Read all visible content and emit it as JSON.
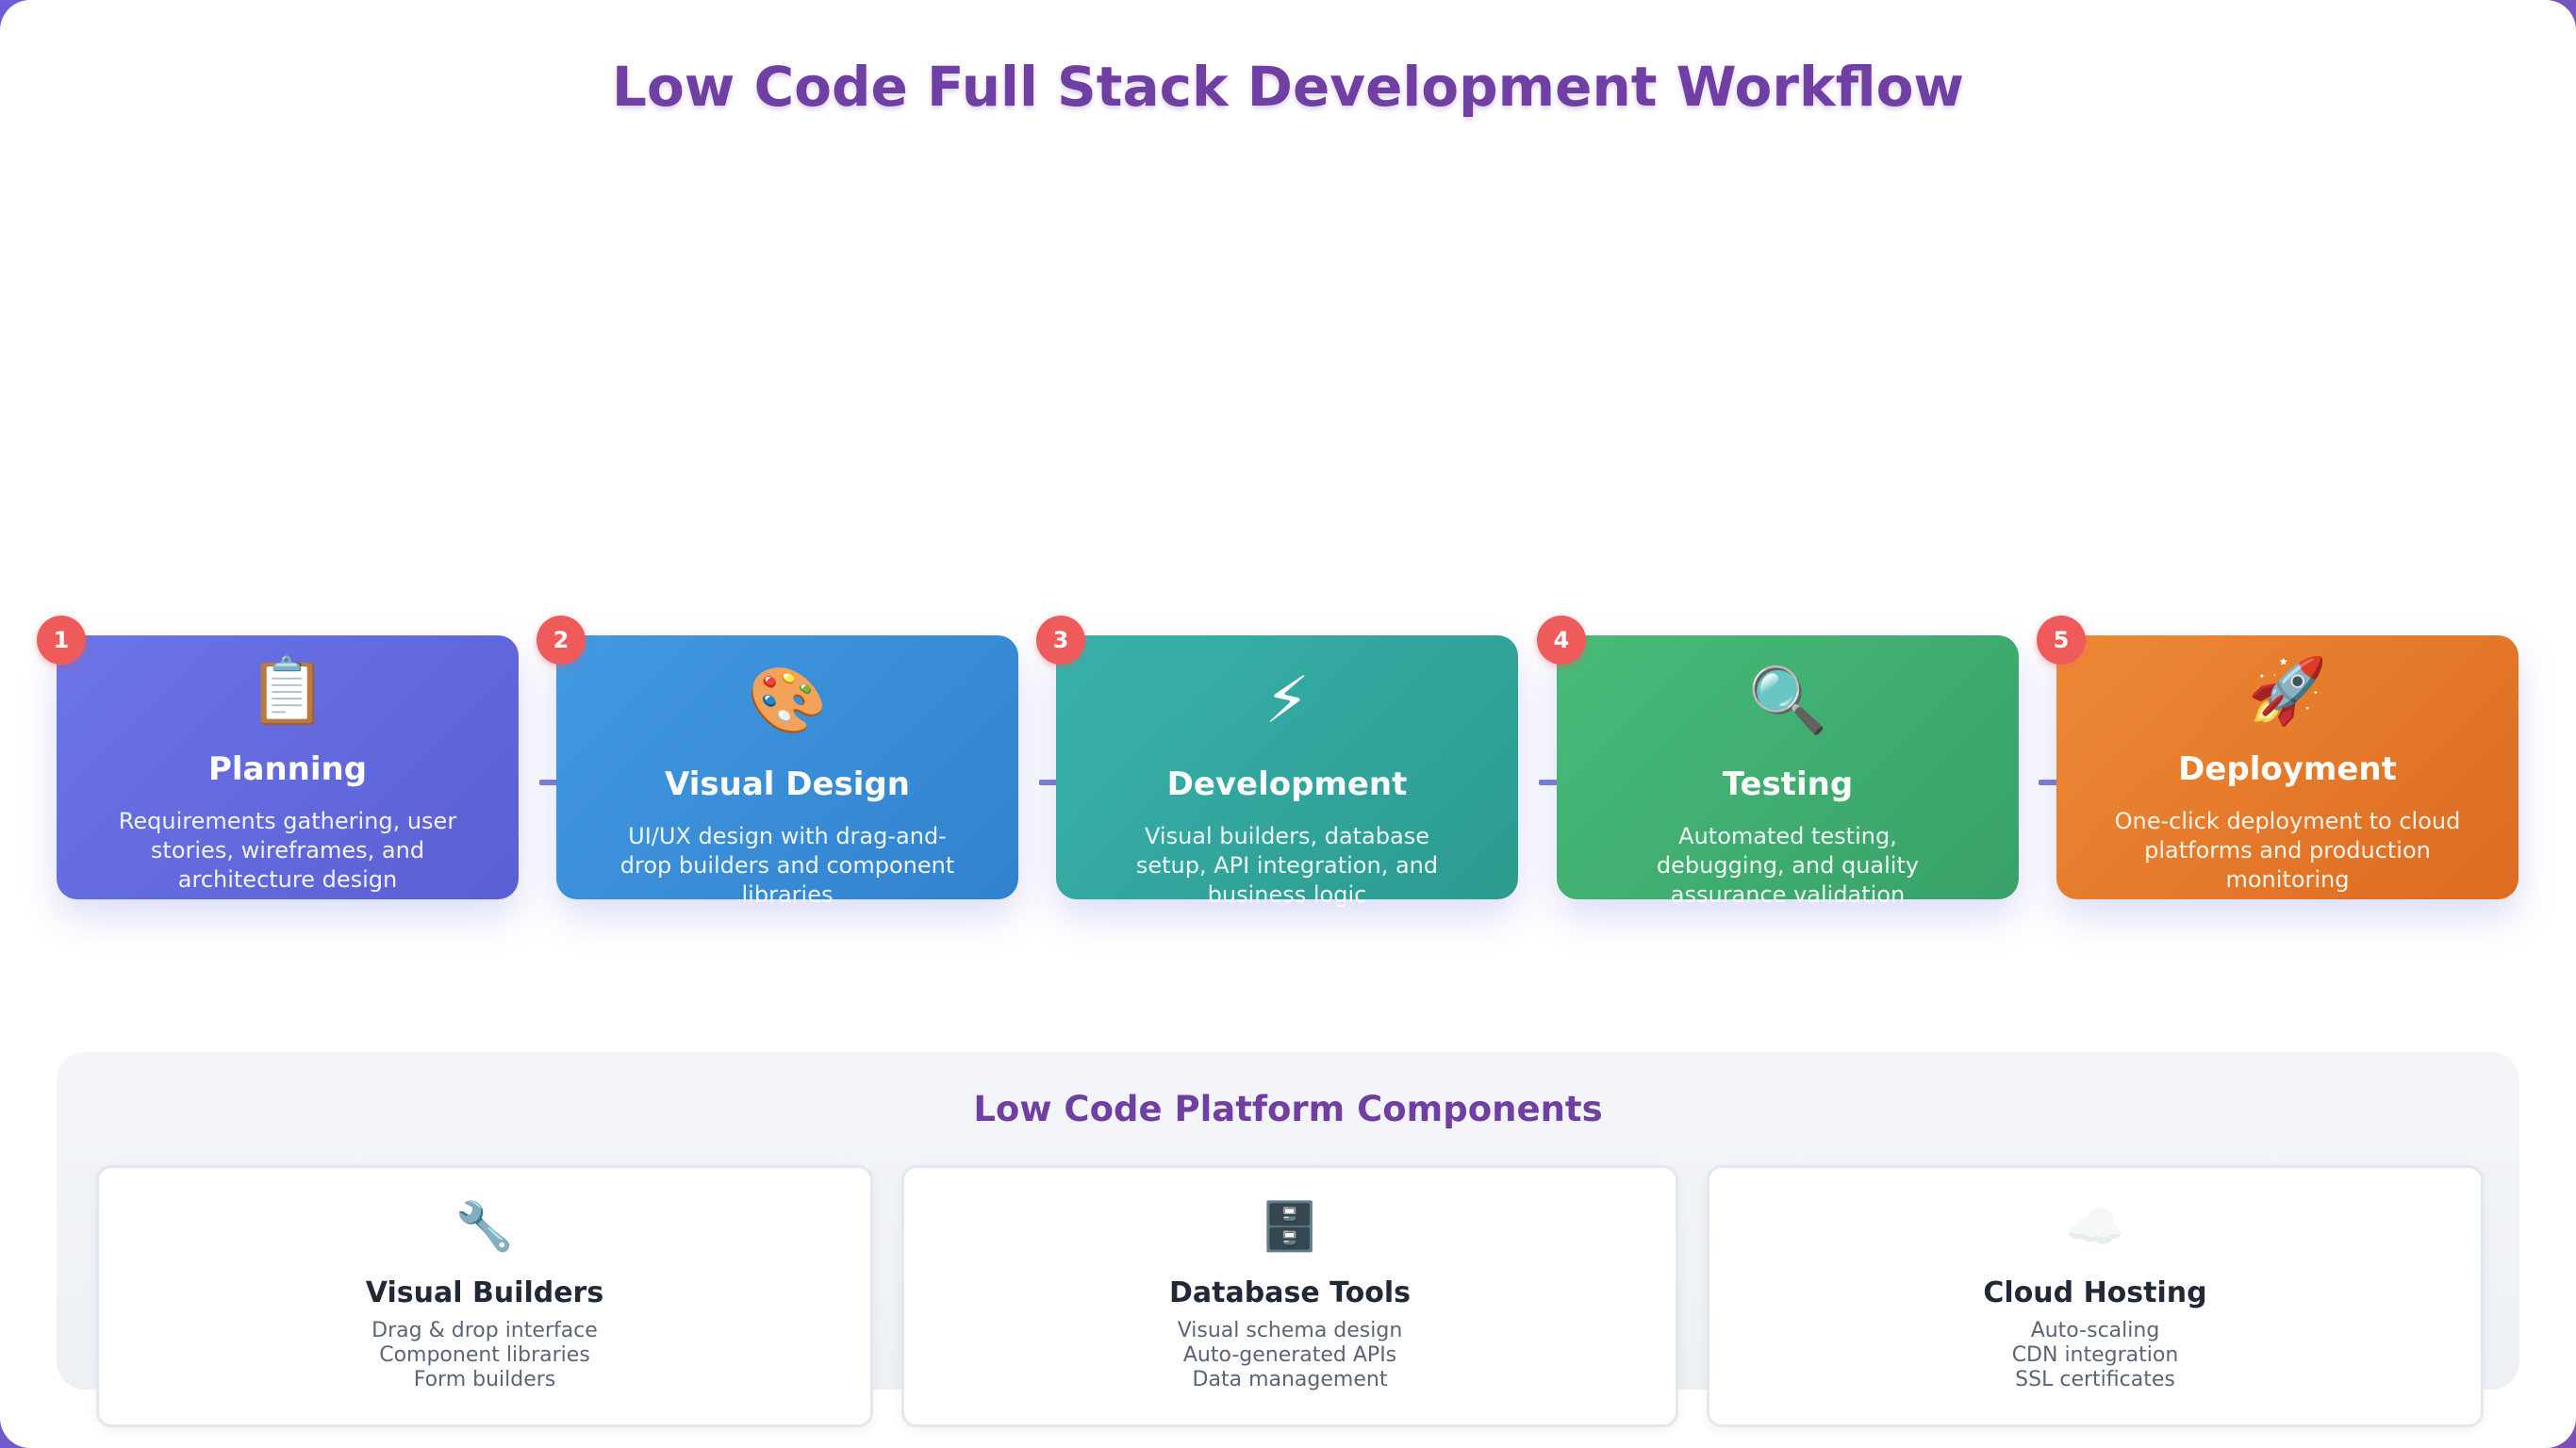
{
  "title": "Low Code Full Stack Development Workflow",
  "steps": [
    {
      "number": "1",
      "icon": "clipboard-icon",
      "glyph": "📋",
      "name": "Planning",
      "description": "Requirements gathering, user stories, wireframes, and architecture design",
      "color_start": "#6b74e8",
      "color_end": "#5b5fd4"
    },
    {
      "number": "2",
      "icon": "palette-icon",
      "glyph": "🎨",
      "name": "Visual Design",
      "description": "UI/UX design with drag-and-drop builders and component libraries",
      "color_start": "#4299e1",
      "color_end": "#3182ce"
    },
    {
      "number": "3",
      "icon": "lightning-icon",
      "glyph": "⚡",
      "name": "Development",
      "description": "Visual builders, database setup, API integration, and business logic",
      "color_start": "#38b2ac",
      "color_end": "#2c9a8f"
    },
    {
      "number": "4",
      "icon": "magnifier-icon",
      "glyph": "🔍",
      "name": "Testing",
      "description": "Automated testing, debugging, and quality assurance validation",
      "color_start": "#48bb78",
      "color_end": "#38a169"
    },
    {
      "number": "5",
      "icon": "rocket-icon",
      "glyph": "🚀",
      "name": "Deployment",
      "description": "One-click deployment to cloud platforms and production monitoring",
      "color_start": "#ed8936",
      "color_end": "#dd6b20"
    }
  ],
  "components": {
    "title": "Low Code Platform Components",
    "items": [
      {
        "icon": "wrench-icon",
        "glyph": "🔧",
        "name": "Visual Builders",
        "lines": [
          "Drag & drop interface",
          "Component libraries",
          "Form builders"
        ]
      },
      {
        "icon": "file-cabinet-icon",
        "glyph": "🗄️",
        "name": "Database Tools",
        "lines": [
          "Visual schema design",
          "Auto-generated APIs",
          "Data management"
        ]
      },
      {
        "icon": "cloud-icon",
        "glyph": "☁️",
        "name": "Cloud Hosting",
        "lines": [
          "Auto-scaling",
          "CDN integration",
          "SSL certificates"
        ]
      }
    ]
  }
}
